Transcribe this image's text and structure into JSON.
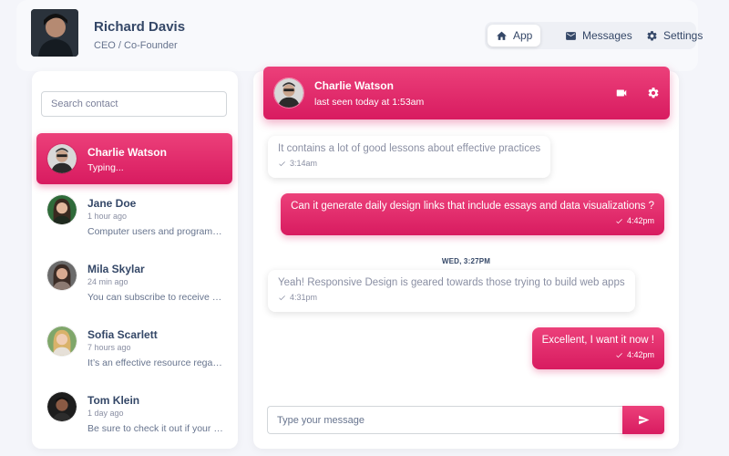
{
  "theme": {
    "accent": "#e91e63",
    "accent_dark": "#d81b60",
    "text_dark": "#344767",
    "text_muted": "#67748e"
  },
  "profile": {
    "name": "Richard Davis",
    "role": "CEO / Co-Founder",
    "avatar_icon": "user-photo"
  },
  "nav": {
    "tabs": [
      {
        "label": "App",
        "icon": "home-icon",
        "active": true
      },
      {
        "label": "Messages",
        "icon": "mail-icon",
        "active": false
      },
      {
        "label": "Settings",
        "icon": "gear-icon",
        "active": false
      }
    ]
  },
  "contacts": {
    "search_placeholder": "Search contact",
    "items": [
      {
        "name": "Charlie Watson",
        "time": "",
        "message": "Typing...",
        "active": true
      },
      {
        "name": "Jane Doe",
        "time": "1 hour ago",
        "message": "Computer users and programmers",
        "active": false
      },
      {
        "name": "Mila Skylar",
        "time": "24 min ago",
        "message": "You can subscribe to receive weekly updates",
        "active": false
      },
      {
        "name": "Sofia Scarlett",
        "time": "7 hours ago",
        "message": "It’s an effective resource regardless",
        "active": false
      },
      {
        "name": "Tom Klein",
        "time": "1 day ago",
        "message": "Be sure to check it out if your dev team",
        "active": false
      }
    ]
  },
  "chat": {
    "header": {
      "name": "Charlie Watson",
      "status": "last seen today at 1:53am",
      "video_icon": "videocam-icon",
      "settings_icon": "gear-icon"
    },
    "messages": [
      {
        "direction": "in",
        "text": "It contains a lot of good lessons about effective practices",
        "time": "3:14am"
      },
      {
        "direction": "out",
        "text": "Can it generate daily design links that include essays and data visualizations ?",
        "time": "4:42pm"
      },
      {
        "direction": "in",
        "text": "Yeah! Responsive Design is geared towards those trying to build web apps",
        "time": "4:31pm"
      },
      {
        "direction": "out",
        "text": "Excellent, I want it now !",
        "time": "4:42pm"
      }
    ],
    "date_separator": "WED, 3:27PM",
    "input_placeholder": "Type your message",
    "send_icon": "send-icon"
  }
}
